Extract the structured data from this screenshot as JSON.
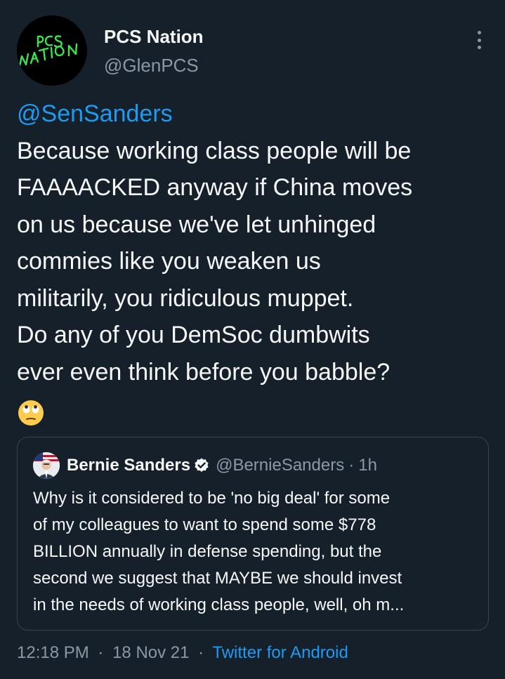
{
  "author": {
    "display_name": "PCS Nation",
    "handle": "@GlenPCS",
    "avatar_text": [
      "PCS",
      "NATION"
    ]
  },
  "tweet": {
    "mention": "@SenSanders",
    "lines": [
      "Because working class people will be",
      "FAAAACKED anyway if China moves",
      "on us because we've let unhinged",
      "commies like you weaken us",
      "militarily, you ridiculous muppet.",
      "Do any of you DemSoc dumbwits",
      "ever even think before you babble?"
    ],
    "emoji": "face-with-rolling-eyes"
  },
  "quoted": {
    "display_name": "Bernie Sanders",
    "handle": "@BernieSanders",
    "separator": "·",
    "time": "1h",
    "lines": [
      "Why is it considered to be 'no big deal' for some",
      "of my colleagues to want to spend some $778",
      "BILLION annually in defense spending, but the",
      "second we suggest that MAYBE we should invest",
      "in the needs of working class people, well, oh m..."
    ]
  },
  "meta": {
    "time": "12:18 PM",
    "sep1": "·",
    "date": "18 Nov 21",
    "sep2": "·",
    "source": "Twitter for Android"
  },
  "colors": {
    "background": "#15202b",
    "text": "#f7f9f9",
    "secondary": "#8b98a5",
    "accent": "#1d9bf0",
    "border": "#38444d",
    "avatar_lettering": "#37e64c"
  },
  "icons": [
    "more-vertical-icon",
    "verified-badge-icon",
    "rolling-eyes-emoji-icon"
  ]
}
